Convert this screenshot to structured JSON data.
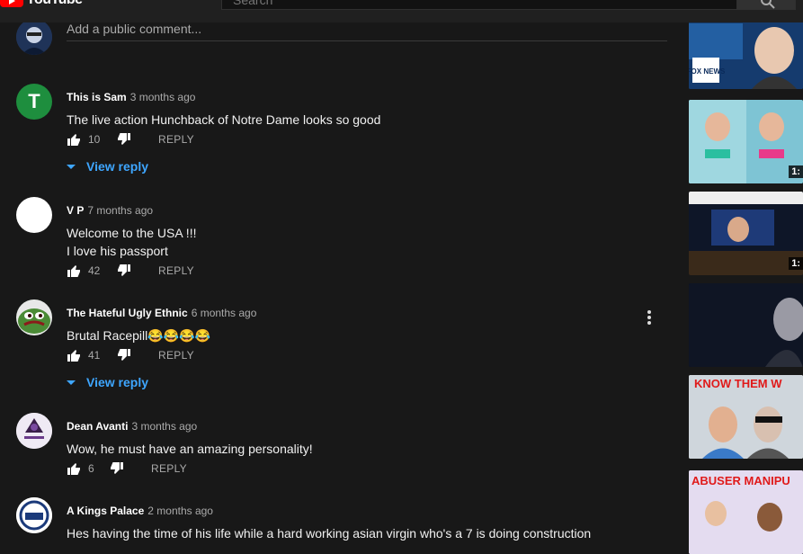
{
  "header": {
    "logo_text": "YouTube",
    "search_placeholder": "Search"
  },
  "add_comment": {
    "placeholder": "Add a public comment..."
  },
  "comments": [
    {
      "author": "This is Sam",
      "time": "3 months ago",
      "text": "The live action Hunchback of Notre Dame looks so good",
      "likes": "10",
      "reply_label": "REPLY",
      "view_replies": "View reply",
      "avatar_letter": "T",
      "avatar_color": "#1e8e3e"
    },
    {
      "author": "V P",
      "time": "7 months ago",
      "text_lines": [
        "Welcome to the USA !!!",
        "I love his passport"
      ],
      "likes": "42",
      "reply_label": "REPLY",
      "avatar_color": "#ffffff"
    },
    {
      "author": "The Hateful Ugly Ethnic",
      "time": "6 months ago",
      "text": "Brutal Racepill😂😂😂😂",
      "likes": "41",
      "reply_label": "REPLY",
      "view_replies": "View reply"
    },
    {
      "author": "Dean Avanti",
      "time": "3 months ago",
      "text": "Wow, he must have an amazing personality!",
      "likes": "6",
      "reply_label": "REPLY"
    },
    {
      "author": "A Kings Palace",
      "time": "2 months ago",
      "text": "Hes having the time of his life while a hard working asian virgin who's a 7 is doing construction"
    }
  ],
  "sidebar": {
    "thumbnails": [
      {
        "label": "FOX NEWS",
        "duration": ""
      },
      {
        "label": "",
        "duration": "1:"
      },
      {
        "label": "",
        "duration": "1:"
      },
      {
        "label": "",
        "duration": ""
      },
      {
        "label": "KNOW THEM W",
        "duration": ""
      },
      {
        "label": "ABUSER MANIPU",
        "duration": ""
      }
    ]
  },
  "colors": {
    "background": "#181818",
    "link_blue": "#3ea6ff",
    "brand_red": "#ff0000"
  }
}
